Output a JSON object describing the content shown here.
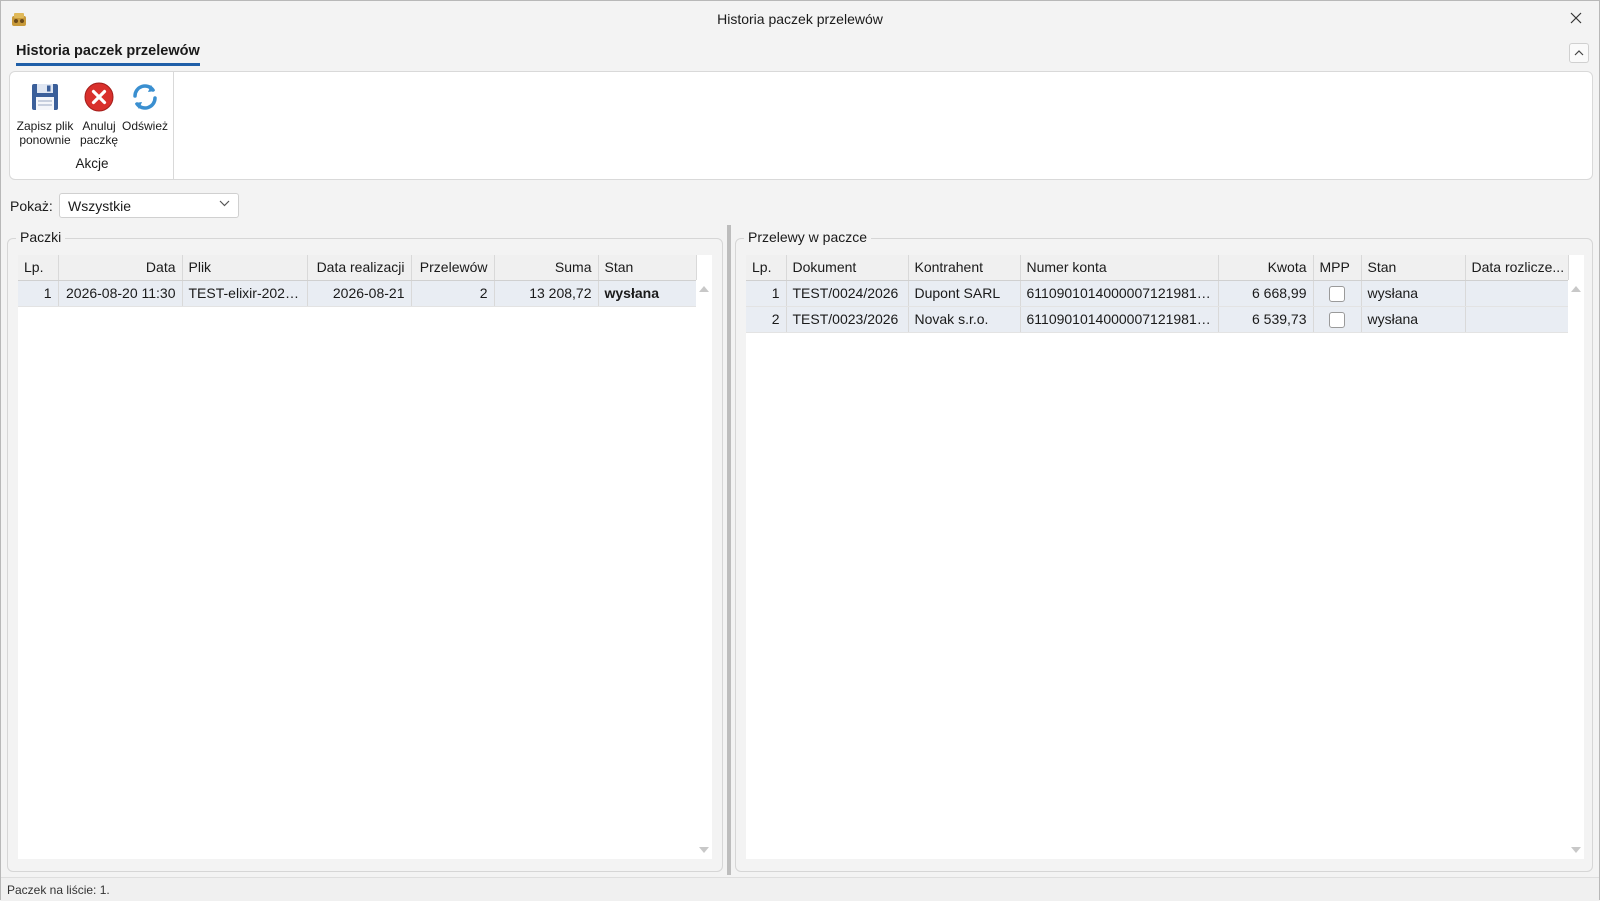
{
  "window": {
    "title": "Historia paczek przelewów"
  },
  "ribbon": {
    "tab_label": "Historia paczek przelewów",
    "group_label": "Akcje",
    "buttons": {
      "save_line1": "Zapisz plik",
      "save_line2": "ponownie",
      "cancel_line1": "Anuluj",
      "cancel_line2": "paczkę",
      "refresh": "Odśwież"
    }
  },
  "filter": {
    "label": "Pokaż:",
    "value": "Wszystkie"
  },
  "packages": {
    "title": "Paczki",
    "columns": [
      "Lp.",
      "Data",
      "Plik",
      "Data realizacji",
      "Przelewów",
      "Suma",
      "Stan"
    ],
    "rows": [
      {
        "lp": "1",
        "date": "2026-08-20 11:30",
        "file": "TEST-elixir-2026...",
        "realization": "2026-08-21",
        "count": "2",
        "sum": "13 208,72",
        "status": "wysłana"
      }
    ]
  },
  "transfers": {
    "title": "Przelewy w paczce",
    "columns": [
      "Lp.",
      "Dokument",
      "Kontrahent",
      "Numer konta",
      "Kwota",
      "MPP",
      "Stan",
      "Data rozlicze..."
    ],
    "rows": [
      {
        "lp": "1",
        "doc": "TEST/0024/2026",
        "contractor": "Dupont SARL",
        "account": "61109010140000071219814...",
        "amount": "6 668,99",
        "mpp": false,
        "status": "wysłana",
        "settle": ""
      },
      {
        "lp": "2",
        "doc": "TEST/0023/2026",
        "contractor": "Novak s.r.o.",
        "account": "61109010140000071219814...",
        "amount": "6 539,73",
        "mpp": false,
        "status": "wysłana",
        "settle": ""
      }
    ]
  },
  "status_bar": {
    "text": "Paczek na liście: 1."
  },
  "colors": {
    "accent": "#1f5fa8",
    "selection": "#e9edf3"
  }
}
